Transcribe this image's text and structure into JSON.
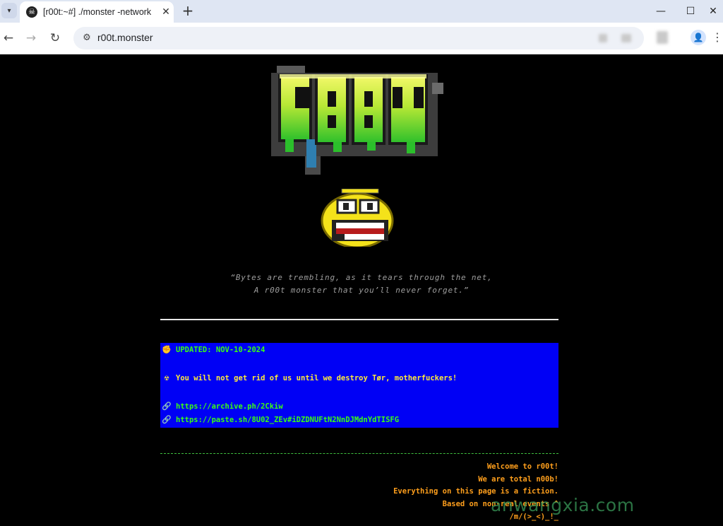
{
  "browser": {
    "tab_title": "[r00t:~#] ./monster -network",
    "tab_menu_icon": "chevron-down-icon",
    "url": "r00t.monster"
  },
  "hero": {
    "logo_text": "r00t",
    "quote_line1": "“Bytes are trembling, as it tears through the net,",
    "quote_line2": "A r00t monster that you’ll never forget.”"
  },
  "notice": {
    "updated": "UPDATED: NOV-10-2024",
    "message": "You will not get rid of us until we destroy Tør, motherfuckers!",
    "links": [
      "https://archive.ph/2Ckiw",
      "https://paste.sh/8U02_ZEv#iDZDNUFtN2NnDJMdnYdTISFG"
    ]
  },
  "footer": {
    "lines": [
      "Welcome to r00t!",
      "We are total n00b!",
      "Everything on this page is a fiction.",
      "Based on non-real events ^",
      "/m/(>_<)_!_"
    ]
  },
  "watermark": "anwangxia.com",
  "colors": {
    "notice_bg": "#0000f5",
    "notice_updated": "#39ff14",
    "notice_message": "#ffeb3b",
    "notice_links": "#39ff14",
    "footer_text": "#ff9f1c",
    "quote_text": "#9e9e9e"
  }
}
